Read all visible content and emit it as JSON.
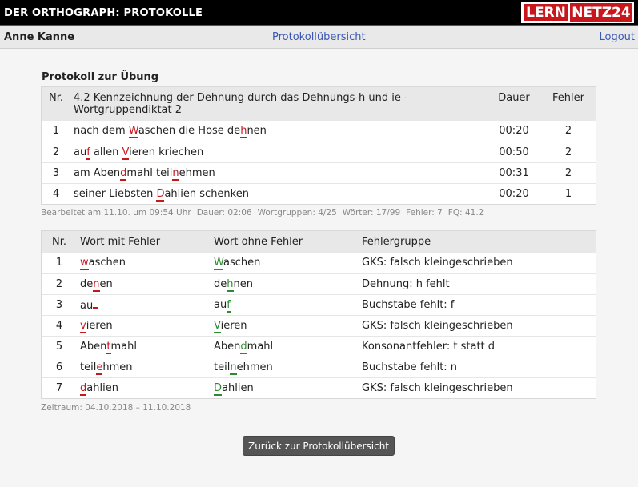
{
  "header": {
    "title": "DER ORTHOGRAPH: PROTOKOLLE",
    "logo": {
      "part1": "LERN",
      "part2": "NETZ",
      "part3": "24"
    }
  },
  "nav": {
    "user": "Anne Kanne",
    "overview_link": "Protokollübersicht",
    "logout": "Logout"
  },
  "section_title": "Protokoll zur Übung",
  "exercise_table": {
    "headers": {
      "nr": "Nr.",
      "title": "4.2 Kennzeichnung der Dehnung durch das Dehnungs-h und ie - Wortgruppendiktat 2",
      "duration": "Dauer",
      "errors": "Fehler"
    },
    "rows": [
      {
        "nr": "1",
        "parts": [
          [
            "nach dem ",
            ""
          ],
          [
            "W",
            "bad"
          ],
          [
            "aschen die Hose de",
            ""
          ],
          [
            "h",
            "bad"
          ],
          [
            "nen",
            ""
          ]
        ],
        "duration": "00:20",
        "errors": "2"
      },
      {
        "nr": "2",
        "parts": [
          [
            "au",
            ""
          ],
          [
            "f",
            "bad"
          ],
          [
            " allen ",
            ""
          ],
          [
            "V",
            "bad"
          ],
          [
            "ieren kriechen",
            ""
          ]
        ],
        "duration": "00:50",
        "errors": "2"
      },
      {
        "nr": "3",
        "parts": [
          [
            "am Aben",
            ""
          ],
          [
            "d",
            "bad"
          ],
          [
            "mahl teil",
            ""
          ],
          [
            "n",
            "bad"
          ],
          [
            "ehmen",
            ""
          ]
        ],
        "duration": "00:31",
        "errors": "2"
      },
      {
        "nr": "4",
        "parts": [
          [
            "seiner Liebsten ",
            ""
          ],
          [
            "D",
            "bad"
          ],
          [
            "ahlien schenken",
            ""
          ]
        ],
        "duration": "00:20",
        "errors": "1"
      }
    ]
  },
  "meta1": [
    "Bearbeitet am 11.10. um 09:54 Uhr",
    "Dauer: 02:06",
    "Wortgruppen: 4/25",
    "Wörter: 17/99",
    "Fehler: 7",
    "FQ: 41.2"
  ],
  "error_table": {
    "headers": {
      "nr": "Nr.",
      "wrong": "Wort mit Fehler",
      "correct": "Wort ohne Fehler",
      "group": "Fehlergruppe"
    },
    "rows": [
      {
        "nr": "1",
        "wrong": [
          [
            "w",
            "bad"
          ],
          [
            "aschen",
            ""
          ]
        ],
        "correct": [
          [
            "W",
            "good"
          ],
          [
            "aschen",
            ""
          ]
        ],
        "group": "GKS: falsch kleingeschrieben"
      },
      {
        "nr": "2",
        "wrong": [
          [
            "de",
            ""
          ],
          [
            "n",
            "bad"
          ],
          [
            "en",
            ""
          ]
        ],
        "correct": [
          [
            "de",
            ""
          ],
          [
            "h",
            "good"
          ],
          [
            "nen",
            ""
          ]
        ],
        "group": "Dehnung: h fehlt"
      },
      {
        "nr": "3",
        "wrong": [
          [
            "au",
            ""
          ],
          [
            "",
            "gap"
          ]
        ],
        "correct": [
          [
            "au",
            ""
          ],
          [
            "f",
            "good"
          ]
        ],
        "group": "Buchstabe fehlt: f"
      },
      {
        "nr": "4",
        "wrong": [
          [
            "v",
            "bad"
          ],
          [
            "ieren",
            ""
          ]
        ],
        "correct": [
          [
            "V",
            "good"
          ],
          [
            "ieren",
            ""
          ]
        ],
        "group": "GKS: falsch kleingeschrieben"
      },
      {
        "nr": "5",
        "wrong": [
          [
            "Aben",
            ""
          ],
          [
            "t",
            "bad"
          ],
          [
            "mahl",
            ""
          ]
        ],
        "correct": [
          [
            "Aben",
            ""
          ],
          [
            "d",
            "good"
          ],
          [
            "mahl",
            ""
          ]
        ],
        "group": "Konsonantfehler: t statt d"
      },
      {
        "nr": "6",
        "wrong": [
          [
            "teil",
            ""
          ],
          [
            "e",
            "bad"
          ],
          [
            "hmen",
            ""
          ]
        ],
        "correct": [
          [
            "teil",
            ""
          ],
          [
            "n",
            "good"
          ],
          [
            "ehmen",
            ""
          ]
        ],
        "group": "Buchstabe fehlt: n"
      },
      {
        "nr": "7",
        "wrong": [
          [
            "d",
            "bad"
          ],
          [
            "ahlien",
            ""
          ]
        ],
        "correct": [
          [
            "D",
            "good"
          ],
          [
            "ahlien",
            ""
          ]
        ],
        "group": "GKS: falsch kleingeschrieben"
      }
    ]
  },
  "meta2": "Zeitraum: 04.10.2018 – 11.10.2018",
  "back_button": "Zurück zur Protokollübersicht",
  "colors": {
    "error": "#c8161d",
    "correct": "#2f8a2f",
    "link": "#3a57b5"
  }
}
